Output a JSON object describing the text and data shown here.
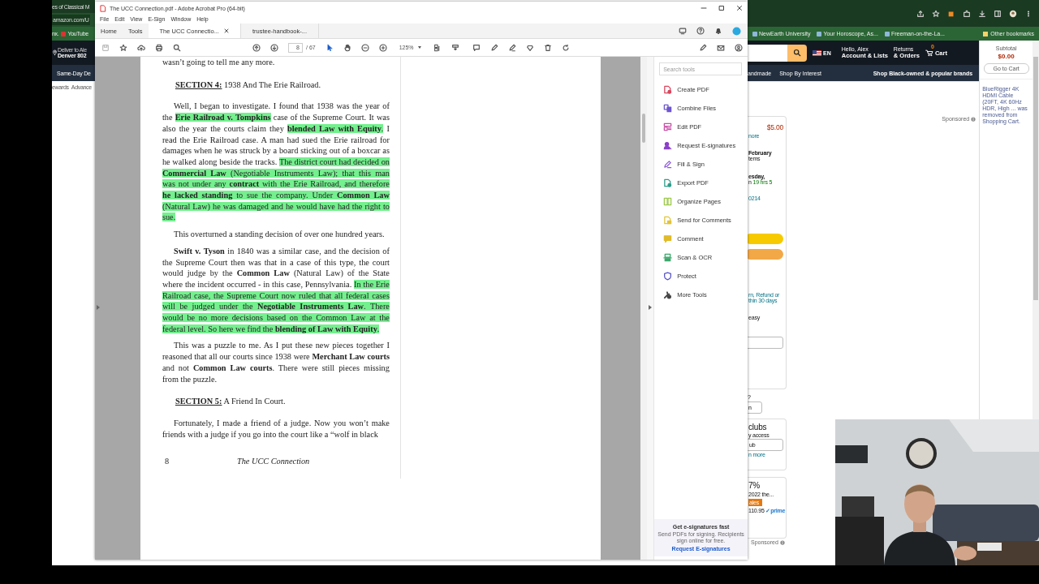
{
  "browser": {
    "tab_title": "es of Classical M",
    "address": "amazon.com/U",
    "bookmarks_left": [
      "nx.",
      "YouTube"
    ],
    "bookmarks_right": [
      "NewEarth University",
      "Your Horoscope, As...",
      "Freeman-on-the-La..."
    ],
    "other_bookmarks": "Other bookmarks",
    "amazon": {
      "deliver_to": "Deliver to Ale",
      "location": "Denver 802",
      "language": "EN",
      "greeting": "Hello, Alex",
      "account": "Account & Lists",
      "returns": "Returns",
      "orders": "& Orders",
      "cart_count": "0",
      "cart": "Cart",
      "nav_left": "Same-Day De",
      "nav_right": [
        "andmade",
        "Shop By Interest"
      ],
      "nav_promo": "Shop Black-owned & popular brands",
      "subnav_left": [
        "ewards",
        "Advance"
      ],
      "sponsored": "Sponsored",
      "buy_box": [
        {
          "kind": "price",
          "text": "$5.00"
        },
        {
          "kind": "link",
          "text": "nore"
        },
        {
          "kind": "bold",
          "text": "February"
        },
        {
          "kind": "text",
          "text": "tems"
        },
        {
          "kind": "bold",
          "text": "esday,"
        },
        {
          "kind": "eta",
          "text": "n",
          "green": "19 hrs 5"
        },
        {
          "kind": "link",
          "text": "0214"
        },
        {
          "kind": "pill",
          "color": "#f7ca00"
        },
        {
          "kind": "pill",
          "color": "#f3a847"
        },
        {
          "kind": "link",
          "text": "rn, Refund or"
        },
        {
          "kind": "link",
          "text": "thin 30 days"
        },
        {
          "kind": "text",
          "text": "easy"
        },
        {
          "kind": "field"
        }
      ],
      "after_box": [
        {
          "kind": "text",
          "text": "?"
        },
        {
          "kind": "field",
          "text": "n"
        }
      ],
      "clubs_card": [
        {
          "kind": "large",
          "text": "clubs"
        },
        {
          "kind": "text",
          "text": "y access"
        },
        {
          "kind": "field",
          "text": "ub"
        },
        {
          "kind": "link",
          "text": "n more"
        }
      ],
      "deal_card": [
        {
          "kind": "large",
          "text": "7%"
        },
        {
          "kind": "text",
          "text": "2022 the..."
        },
        {
          "kind": "badge",
          "text": "ales"
        },
        {
          "kind": "price_prime",
          "text": "110.95",
          "prime": "✓prime"
        }
      ],
      "sponsored_bottom": "Sponsored",
      "cart_panel": {
        "subtotal_label": "Subtotal",
        "subtotal": "$0.00",
        "button": "Go to Cart",
        "notice": "BlueRigger 4K HDMI Cable (20FT, 4K 60Hz HDR, High ... was removed from Shopping Cart."
      }
    }
  },
  "acrobat": {
    "title": "The UCC Connection.pdf - Adobe Acrobat Pro (64-bit)",
    "menu": [
      "File",
      "Edit",
      "View",
      "E-Sign",
      "Window",
      "Help"
    ],
    "tabs": [
      {
        "label": "Home",
        "kind": "nav",
        "selected": false
      },
      {
        "label": "Tools",
        "kind": "nav",
        "selected": false
      },
      {
        "label": "The UCC Connectio...",
        "kind": "doc",
        "selected": true
      },
      {
        "label": "trustee-handbook-...",
        "kind": "doc",
        "selected": false
      }
    ],
    "page": "8",
    "page_count": "/ 67",
    "zoom": "125%",
    "document": {
      "paragraphs": [
        {
          "kind": "continuation",
          "segments": [
            {
              "text": "wasn’t going to tell me any more.",
              "highlighted": false
            }
          ]
        },
        {
          "kind": "heading",
          "label": "SECTION 4:",
          "title": "1938 And The Erie Railroad."
        },
        {
          "kind": "body",
          "segments": [
            {
              "text": "Well, I began to investigate. I found that 1938 was the year of the ",
              "highlighted": false
            },
            {
              "text": "**Erie Railroad v. Tompkins**",
              "highlighted": true
            },
            {
              "text": " case of the Supreme Court. It was also the year the courts claim they ",
              "highlighted": false
            },
            {
              "text": "**blended Law with Equity**.",
              "highlighted": true
            },
            {
              "text": " I read the Erie Railroad case. A man had sued the Erie railroad for damages when he was struck by a board sticking out of a boxcar as he walked along beside the tracks. ",
              "highlighted": false
            },
            {
              "text": "The district court had decided on **Commercial Law** (Negotiable Instruments Law); that this man was not under any **contract** with the Erie Railroad, and therefore **he lacked standing** to sue the company. Under **Common Law** (Natural Law) he was damaged and he would have had the right to sue.",
              "highlighted": true
            }
          ]
        },
        {
          "kind": "body",
          "segments": [
            {
              "text": "This overturned a standing decision of over one hundred years.",
              "highlighted": false
            }
          ]
        },
        {
          "kind": "body",
          "segments": [
            {
              "text": "**Swift v. Tyson** in 1840 was a similar case, and the decision of the Supreme Court then was that in a case of this type, the court would judge by the **Common Law** (Natural Law) of the State where the incident occurred - in this case, Pennsylvania. ",
              "highlighted": false
            },
            {
              "text": "In the Erie Railroad case, the Supreme Court now ruled that all federal cases will be judged under the **Negotiable Instruments Law**. There would be no more decisions based on the Common Law at the federal level. So here we find the **blending of Law with Equity**.",
              "highlighted": true
            }
          ]
        },
        {
          "kind": "body",
          "segments": [
            {
              "text": "This was a puzzle to me. As I put these new pieces together I reasoned that all our courts since 1938 were **Merchant Law courts** and not **Common Law courts**. There were still pieces missing from the puzzle.",
              "highlighted": false
            }
          ]
        },
        {
          "kind": "heading",
          "label": "SECTION 5:",
          "title": "A Friend In Court."
        },
        {
          "kind": "body",
          "segments": [
            {
              "text": "Fortunately, I made a friend of a judge. Now you won’t make friends with a judge if you go into the court like a “wolf in black",
              "highlighted": false
            }
          ]
        }
      ],
      "page_number": "8",
      "running_title": "The UCC Connection"
    },
    "tools_search": {
      "placeholder": "Search tools"
    },
    "tools": [
      {
        "label": "Create PDF",
        "color": "#d9465c"
      },
      {
        "label": "Combine Files",
        "color": "#6e56cf"
      },
      {
        "label": "Edit PDF",
        "color": "#c84fa6"
      },
      {
        "label": "Request E-signatures",
        "color": "#8b3fc9"
      },
      {
        "label": "Fill & Sign",
        "color": "#8a5ad6"
      },
      {
        "label": "Export PDF",
        "color": "#2e9e8a"
      },
      {
        "label": "Organize Pages",
        "color": "#9cc94a"
      },
      {
        "label": "Send for Comments",
        "color": "#e2c43a"
      },
      {
        "label": "Comment",
        "color": "#e0bb2a"
      },
      {
        "label": "Scan & OCR",
        "color": "#3ba76b"
      },
      {
        "label": "Protect",
        "color": "#5a56c9"
      },
      {
        "label": "More Tools",
        "color": "#444444"
      }
    ],
    "promo": {
      "title": "Get e-signatures fast",
      "text": "Send PDFs for signing. Recipients sign online for free.",
      "link": "Request E-signatures"
    }
  }
}
